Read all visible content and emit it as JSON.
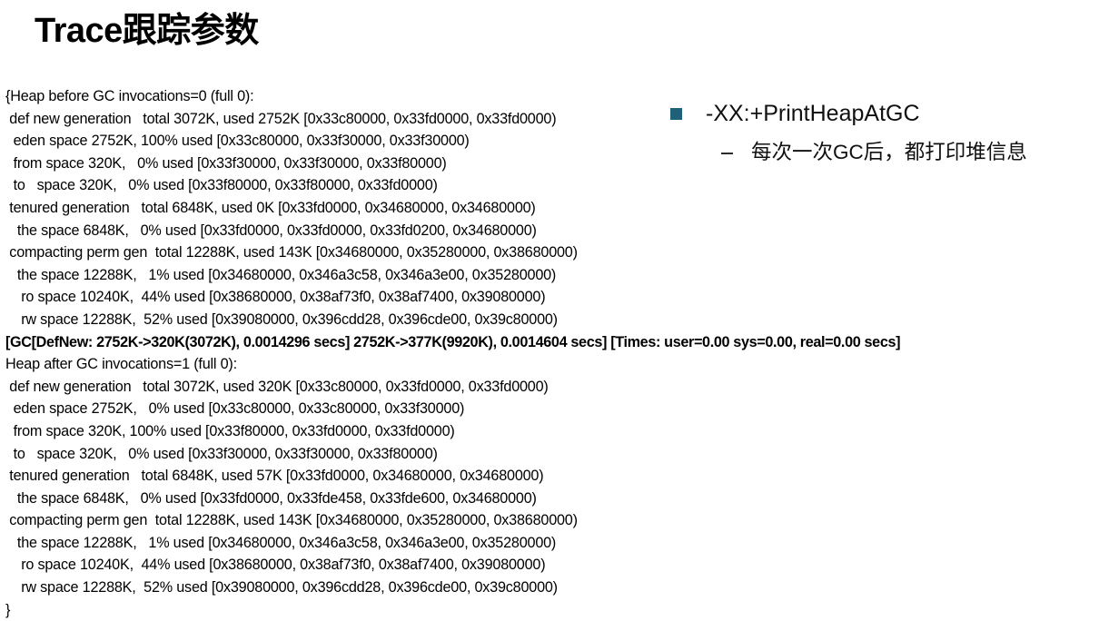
{
  "slide": {
    "title": "Trace跟踪参数",
    "background_color": "#ffffff",
    "text_color": "#000000",
    "accent_color": "#1f6179"
  },
  "log": {
    "lines": [
      {
        "text": "{Heap before GC invocations=0 (full 0):",
        "bold": false
      },
      {
        "text": " def new generation   total 3072K, used 2752K [0x33c80000, 0x33fd0000, 0x33fd0000)",
        "bold": false
      },
      {
        "text": "  eden space 2752K, 100% used [0x33c80000, 0x33f30000, 0x33f30000)",
        "bold": false
      },
      {
        "text": "  from space 320K,   0% used [0x33f30000, 0x33f30000, 0x33f80000)",
        "bold": false
      },
      {
        "text": "  to   space 320K,   0% used [0x33f80000, 0x33f80000, 0x33fd0000)",
        "bold": false
      },
      {
        "text": " tenured generation   total 6848K, used 0K [0x33fd0000, 0x34680000, 0x34680000)",
        "bold": false
      },
      {
        "text": "   the space 6848K,   0% used [0x33fd0000, 0x33fd0000, 0x33fd0200, 0x34680000)",
        "bold": false
      },
      {
        "text": " compacting perm gen  total 12288K, used 143K [0x34680000, 0x35280000, 0x38680000)",
        "bold": false
      },
      {
        "text": "   the space 12288K,   1% used [0x34680000, 0x346a3c58, 0x346a3e00, 0x35280000)",
        "bold": false
      },
      {
        "text": "    ro space 10240K,  44% used [0x38680000, 0x38af73f0, 0x38af7400, 0x39080000)",
        "bold": false
      },
      {
        "text": "    rw space 12288K,  52% used [0x39080000, 0x396cdd28, 0x396cde00, 0x39c80000)",
        "bold": false
      },
      {
        "text": "[GC[DefNew: 2752K->320K(3072K), 0.0014296 secs] 2752K->377K(9920K), 0.0014604 secs] [Times: user=0.00 sys=0.00, real=0.00 secs]",
        "bold": true
      },
      {
        "text": "Heap after GC invocations=1 (full 0):",
        "bold": false
      },
      {
        "text": " def new generation   total 3072K, used 320K [0x33c80000, 0x33fd0000, 0x33fd0000)",
        "bold": false
      },
      {
        "text": "  eden space 2752K,   0% used [0x33c80000, 0x33c80000, 0x33f30000)",
        "bold": false
      },
      {
        "text": "  from space 320K, 100% used [0x33f80000, 0x33fd0000, 0x33fd0000)",
        "bold": false
      },
      {
        "text": "  to   space 320K,   0% used [0x33f30000, 0x33f30000, 0x33f80000)",
        "bold": false
      },
      {
        "text": " tenured generation   total 6848K, used 57K [0x33fd0000, 0x34680000, 0x34680000)",
        "bold": false
      },
      {
        "text": "   the space 6848K,   0% used [0x33fd0000, 0x33fde458, 0x33fde600, 0x34680000)",
        "bold": false
      },
      {
        "text": " compacting perm gen  total 12288K, used 143K [0x34680000, 0x35280000, 0x38680000)",
        "bold": false
      },
      {
        "text": "   the space 12288K,   1% used [0x34680000, 0x346a3c58, 0x346a3e00, 0x35280000)",
        "bold": false
      },
      {
        "text": "    ro space 10240K,  44% used [0x38680000, 0x38af73f0, 0x38af7400, 0x39080000)",
        "bold": false
      },
      {
        "text": "    rw space 12288K,  52% used [0x39080000, 0x396cdd28, 0x396cde00, 0x39c80000)",
        "bold": false
      },
      {
        "text": "}",
        "bold": false
      }
    ]
  },
  "bullets": {
    "primary": {
      "marker": "square-bullet-icon",
      "label": "-XX:+PrintHeapAtGC"
    },
    "sub": {
      "marker": "dash-bullet-icon",
      "label": "每次一次GC后，都打印堆信息"
    }
  }
}
